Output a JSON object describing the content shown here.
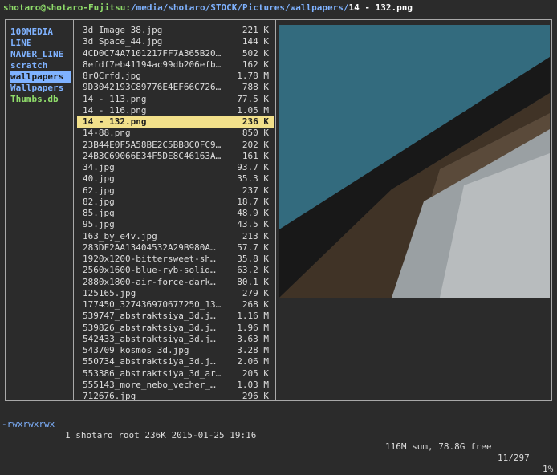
{
  "title": {
    "user_host": "shotaro@shotaro-Fujitsu:",
    "path": "/media/shotaro/STOCK/Pictures/wallpapers/",
    "file": "14 - 132.png"
  },
  "parent_dir": [
    {
      "name": "100MEDIA",
      "type": "dir",
      "selected": false
    },
    {
      "name": "LINE",
      "type": "dir",
      "selected": false
    },
    {
      "name": "NAVER_LINE",
      "type": "dir",
      "selected": false
    },
    {
      "name": "scratch",
      "type": "dir",
      "selected": false
    },
    {
      "name": "wallpapers",
      "type": "dir",
      "selected": true
    },
    {
      "name": "Wallpapers",
      "type": "dir",
      "selected": false
    },
    {
      "name": "Thumbs.db",
      "type": "file",
      "selected": false
    }
  ],
  "files": [
    {
      "name": "3d Image_38.jpg",
      "size": "221 K"
    },
    {
      "name": "3d Space_44.jpg",
      "size": "144 K"
    },
    {
      "name": "4CD0C74A7101217FF7A365B20…",
      "size": "502 K"
    },
    {
      "name": "8efdf7eb41194ac99db206efb…",
      "size": "162 K"
    },
    {
      "name": "8rQCrfd.jpg",
      "size": "1.78 M"
    },
    {
      "name": "9D3042193C89776E4EF66C726…",
      "size": "788 K"
    },
    {
      "name": "14 - 113.png",
      "size": "77.5 K"
    },
    {
      "name": "14 - 116.png",
      "size": "1.05 M"
    },
    {
      "name": "14 - 132.png",
      "size": "236 K",
      "selected": true
    },
    {
      "name": "14-88.png",
      "size": "850 K"
    },
    {
      "name": "23B44E0F5A58BE2C5BB8C0FC9…",
      "size": "202 K"
    },
    {
      "name": "24B3C69066E34F5DE8C46163A…",
      "size": "161 K"
    },
    {
      "name": "34.jpg",
      "size": "93.7 K"
    },
    {
      "name": "40.jpg",
      "size": "35.3 K"
    },
    {
      "name": "62.jpg",
      "size": "237 K"
    },
    {
      "name": "82.jpg",
      "size": "18.7 K"
    },
    {
      "name": "85.jpg",
      "size": "48.9 K"
    },
    {
      "name": "95.jpg",
      "size": "43.5 K"
    },
    {
      "name": "163_by_e4v.jpg",
      "size": "213 K"
    },
    {
      "name": "283DF2AA13404532A29B980A…",
      "size": "57.7 K"
    },
    {
      "name": "1920x1200-bittersweet-sh…",
      "size": "35.8 K"
    },
    {
      "name": "2560x1600-blue-ryb-solid…",
      "size": "63.2 K"
    },
    {
      "name": "2880x1800-air-force-dark…",
      "size": "80.1 K"
    },
    {
      "name": "125165.jpg",
      "size": "279 K"
    },
    {
      "name": "177450_327436970677250_13…",
      "size": "268 K"
    },
    {
      "name": "539747_abstraktsiya_3d.j…",
      "size": "1.16 M"
    },
    {
      "name": "539826_abstraktsiya_3d.j…",
      "size": "1.96 M"
    },
    {
      "name": "542433_abstraktsiya_3d.j…",
      "size": "3.63 M"
    },
    {
      "name": "543709_kosmos_3d.jpg",
      "size": "3.28 M"
    },
    {
      "name": "550734_abstraktsiya_3d.j…",
      "size": "2.06 M"
    },
    {
      "name": "553386_abstraktsiya_3d_ar…",
      "size": "205 K"
    },
    {
      "name": "555143_more_nebo_vecher_…",
      "size": "1.03 M"
    },
    {
      "name": "712676.jpg",
      "size": "296 K"
    }
  ],
  "status": {
    "permissions": "-rwxrwxrwx",
    "info": "1 shotaro root 236K 2015-01-25 19:16",
    "disk": "116M sum, 78.8G free",
    "position": "11/297",
    "percent": "1%"
  },
  "colors": {
    "dir": "#7fb2ff",
    "file_exec": "#8fdc6a",
    "selection": "#f2e08a",
    "background": "#2b2b2b"
  }
}
